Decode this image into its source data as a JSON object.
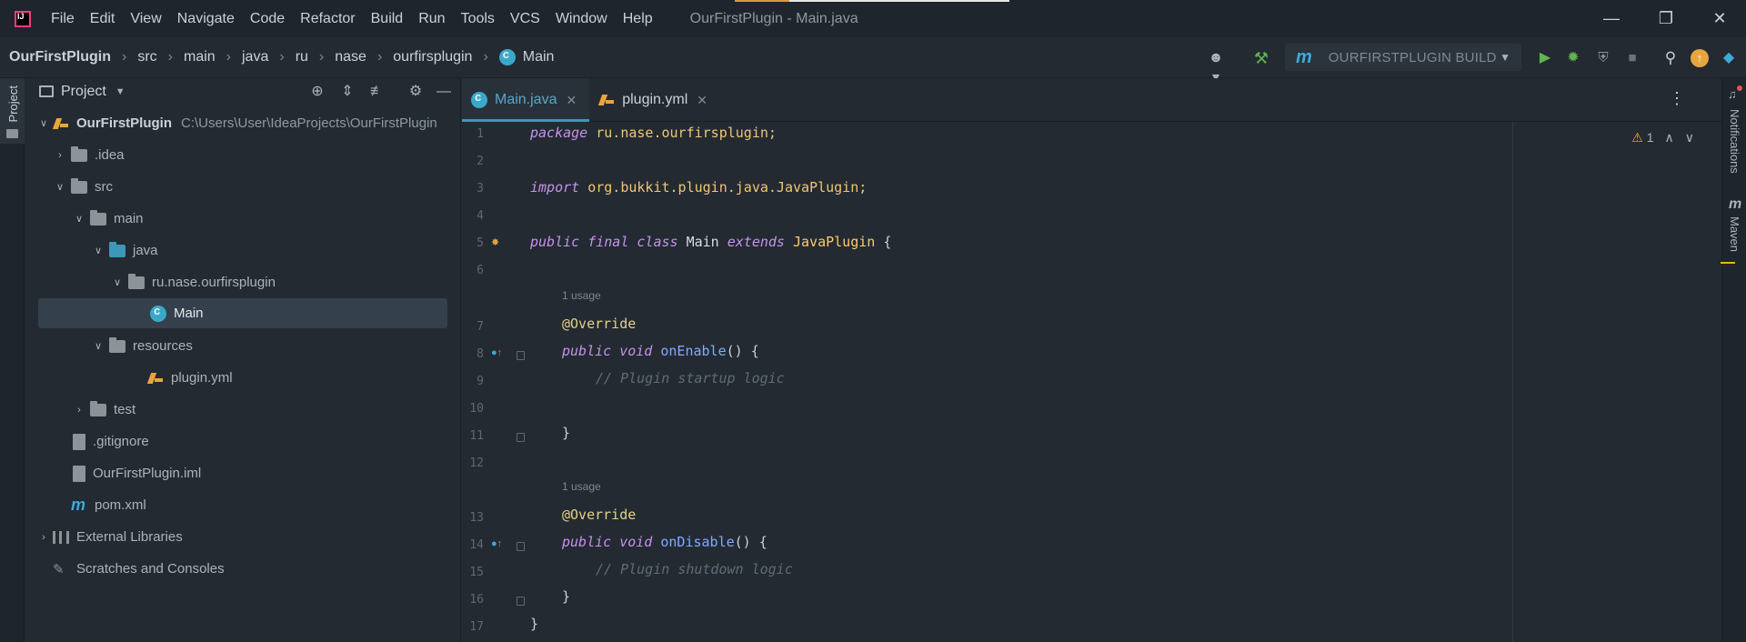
{
  "window": {
    "title": "OurFirstPlugin - Main.java",
    "minimize_icon": "minimize-icon",
    "restore_icon": "restore-icon",
    "close_icon": "close-icon"
  },
  "menu": [
    "File",
    "Edit",
    "View",
    "Navigate",
    "Code",
    "Refactor",
    "Build",
    "Run",
    "Tools",
    "VCS",
    "Window",
    "Help"
  ],
  "breadcrumb": [
    "OurFirstPlugin",
    "src",
    "main",
    "java",
    "ru",
    "nase",
    "ourfirsplugin",
    "Main"
  ],
  "run_config": {
    "label": "OURFIRSTPLUGIN BUILD"
  },
  "project_panel": {
    "title": "Project",
    "tree": [
      {
        "label": "OurFirstPlugin",
        "path": "C:\\Users\\User\\IdeaProjects\\OurFirstPlugin"
      },
      {
        "label": ".idea"
      },
      {
        "label": "src"
      },
      {
        "label": "main"
      },
      {
        "label": "java"
      },
      {
        "label": "ru.nase.ourfirsplugin"
      },
      {
        "label": "Main"
      },
      {
        "label": "resources"
      },
      {
        "label": "plugin.yml"
      },
      {
        "label": "test"
      },
      {
        "label": ".gitignore"
      },
      {
        "label": "OurFirstPlugin.iml"
      },
      {
        "label": "pom.xml"
      },
      {
        "label": "External Libraries"
      },
      {
        "label": "Scratches and Consoles"
      }
    ]
  },
  "tabs": [
    {
      "label": "Main.java",
      "active": true
    },
    {
      "label": "plugin.yml",
      "active": false
    }
  ],
  "editor": {
    "line_numbers": [
      "1",
      "2",
      "3",
      "4",
      "5",
      "6",
      "7",
      "8",
      "9",
      "10",
      "11",
      "12",
      "13",
      "14",
      "15",
      "16",
      "17"
    ],
    "code": {
      "l1_kw": "package",
      "l1_rest": " ru.nase.ourfirsplugin;",
      "l3_kw": "import",
      "l3_rest": " org.bukkit.plugin.java.JavaPlugin;",
      "l5_kw": "public final class",
      "l5_name": " Main ",
      "l5_ext": "extends",
      "l5_base": " JavaPlugin",
      "l5_brace": " {",
      "usage1": "1 usage",
      "l7": "@Override",
      "l8_kw": "public void",
      "l8_fn": " onEnable",
      "l8_rest": "() {",
      "l9": "// Plugin startup logic",
      "l11": "}",
      "usage2": "1 usage",
      "l13": "@Override",
      "l14_kw": "public void",
      "l14_fn": " onDisable",
      "l14_rest": "() {",
      "l15": "// Plugin shutdown logic",
      "l16": "}",
      "l17": "}"
    },
    "warnings_count": "1"
  },
  "side_tools": {
    "left": "Project",
    "right_notifications": "Notifications",
    "right_maven": "Maven"
  },
  "colors": {
    "accent": "#3d97b6",
    "background": "#232a32",
    "keyword": "#c792ea"
  }
}
